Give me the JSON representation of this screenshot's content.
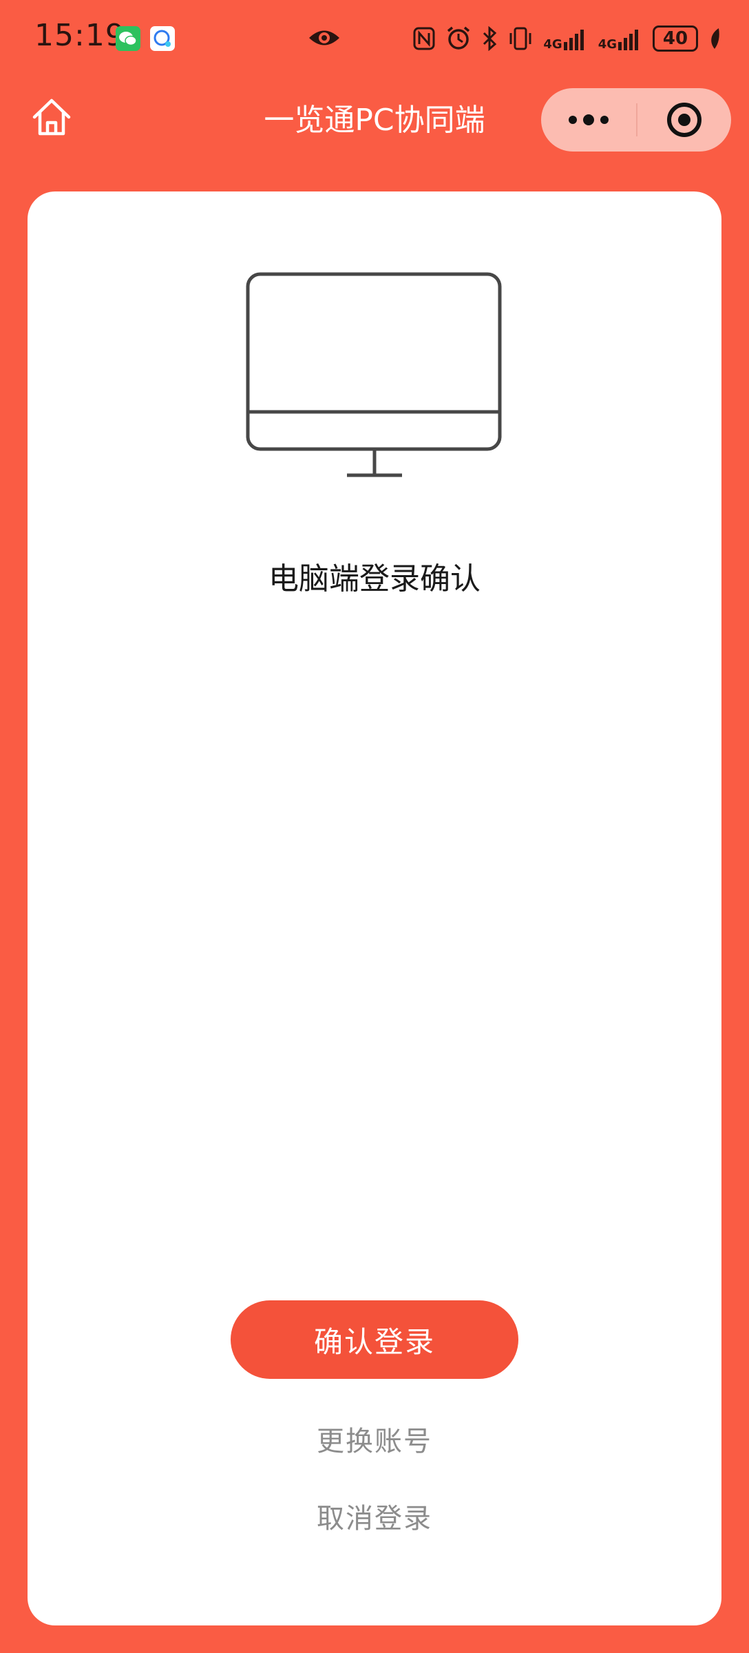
{
  "status_bar": {
    "time": "15:19",
    "signal_label_1": "4G",
    "signal_label_2": "4G",
    "battery": "40"
  },
  "nav": {
    "title": "一览通PC协同端"
  },
  "card": {
    "title": "电脑端登录确认",
    "confirm_label": "确认登录",
    "switch_account_label": "更换账号",
    "cancel_label": "取消登录"
  },
  "colors": {
    "brand": "#fa5c44",
    "button": "#f4523a",
    "capsule": "#fcbcb1",
    "link_text": "#8c8c8c"
  }
}
